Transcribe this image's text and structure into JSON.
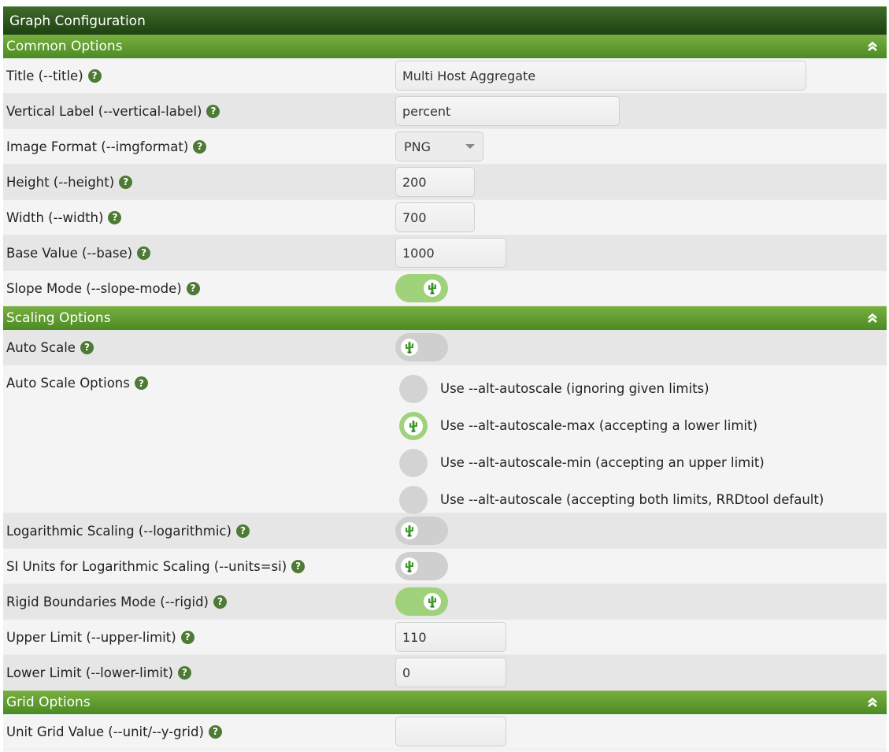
{
  "panel_title": "Graph Configuration",
  "help_glyph": "?",
  "sections": {
    "common": "Common Options",
    "scaling": "Scaling Options",
    "grid": "Grid Options"
  },
  "common": {
    "title_label": "Title (--title)",
    "title_value": "Multi Host Aggregate",
    "vlabel_label": "Vertical Label (--vertical-label)",
    "vlabel_value": "percent",
    "imgformat_label": "Image Format (--imgformat)",
    "imgformat_value": "PNG",
    "height_label": "Height (--height)",
    "height_value": "200",
    "width_label": "Width (--width)",
    "width_value": "700",
    "base_label": "Base Value (--base)",
    "base_value": "1000",
    "slope_label": "Slope Mode (--slope-mode)",
    "slope_on": true
  },
  "scaling": {
    "autoscale_label": "Auto Scale",
    "autoscale_on": false,
    "autoscale_options_label": "Auto Scale Options",
    "autoscale_options": [
      {
        "label": "Use --alt-autoscale (ignoring given limits)",
        "selected": false
      },
      {
        "label": "Use --alt-autoscale-max (accepting a lower limit)",
        "selected": true
      },
      {
        "label": "Use --alt-autoscale-min (accepting an upper limit)",
        "selected": false
      },
      {
        "label": "Use --alt-autoscale (accepting both limits, RRDtool default)",
        "selected": false
      }
    ],
    "log_label": "Logarithmic Scaling (--logarithmic)",
    "log_on": false,
    "si_label": "SI Units for Logarithmic Scaling (--units=si)",
    "si_on": false,
    "rigid_label": "Rigid Boundaries Mode (--rigid)",
    "rigid_on": true,
    "upper_label": "Upper Limit (--upper-limit)",
    "upper_value": "110",
    "lower_label": "Lower Limit (--lower-limit)",
    "lower_value": "0"
  },
  "grid": {
    "unit_label": "Unit Grid Value (--unit/--y-grid)",
    "unit_value": ""
  },
  "colors": {
    "accent_green": "#4c8a24",
    "toggle_on": "#9fd27b",
    "toggle_off": "#cfcfcf",
    "help_icon": "#4d7a34"
  }
}
